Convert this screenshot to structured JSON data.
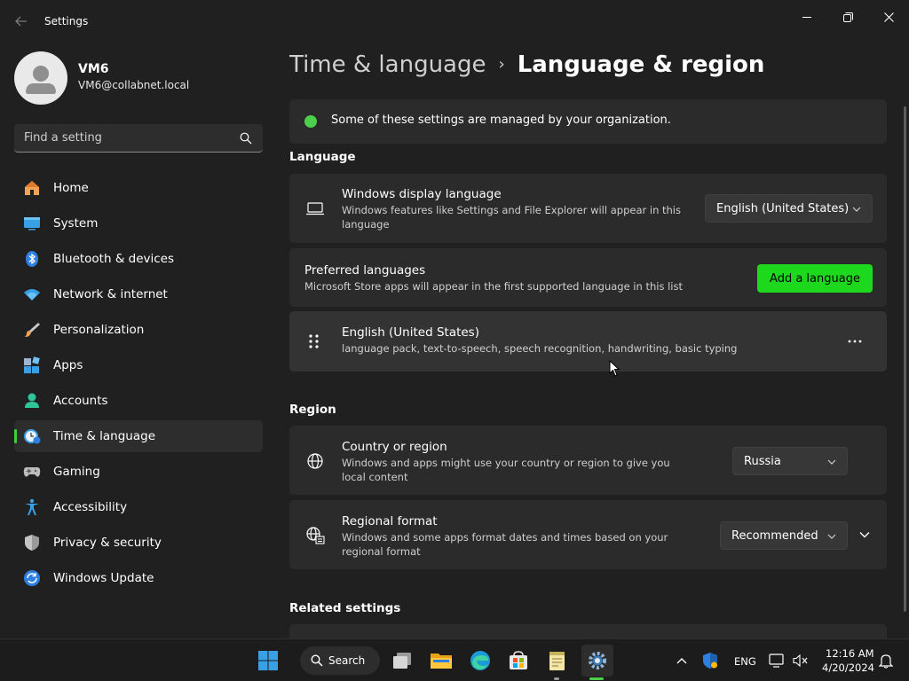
{
  "window": {
    "title": "Settings"
  },
  "profile": {
    "name": "VM6",
    "email": "VM6@collabnet.local"
  },
  "search": {
    "placeholder": "Find a setting"
  },
  "nav": {
    "items": [
      {
        "label": "Home",
        "icon": "home-icon"
      },
      {
        "label": "System",
        "icon": "system-icon"
      },
      {
        "label": "Bluetooth & devices",
        "icon": "bluetooth-icon"
      },
      {
        "label": "Network & internet",
        "icon": "wifi-icon"
      },
      {
        "label": "Personalization",
        "icon": "brush-icon"
      },
      {
        "label": "Apps",
        "icon": "apps-icon"
      },
      {
        "label": "Accounts",
        "icon": "accounts-icon"
      },
      {
        "label": "Time & language",
        "icon": "time-language-icon",
        "active": true
      },
      {
        "label": "Gaming",
        "icon": "gamepad-icon"
      },
      {
        "label": "Accessibility",
        "icon": "accessibility-icon"
      },
      {
        "label": "Privacy & security",
        "icon": "shield-icon"
      },
      {
        "label": "Windows Update",
        "icon": "update-icon"
      }
    ]
  },
  "breadcrumb": {
    "parent": "Time & language",
    "current": "Language & region"
  },
  "notice": {
    "text": "Some of these settings are managed by your organization."
  },
  "language": {
    "section_title": "Language",
    "display": {
      "title": "Windows display language",
      "description": "Windows features like Settings and File Explorer will appear in this language",
      "value": "English (United States)"
    },
    "preferred": {
      "title": "Preferred languages",
      "description": "Microsoft Store apps will appear in the first supported language in this list",
      "button": "Add a language"
    },
    "entry": {
      "title": "English (United States)",
      "description": "language pack, text-to-speech, speech recognition, handwriting, basic typing"
    }
  },
  "region": {
    "section_title": "Region",
    "country": {
      "title": "Country or region",
      "description": "Windows and apps might use your country or region to give you local content",
      "value": "Russia"
    },
    "format": {
      "title": "Regional format",
      "description": "Windows and some apps format dates and times based on your regional format",
      "value": "Recommended"
    }
  },
  "related": {
    "section_title": "Related settings"
  },
  "taskbar": {
    "search_label": "Search",
    "language": "ENG",
    "time": "12:16 AM",
    "date": "4/20/2024"
  },
  "colors": {
    "accent": "#3ad23a",
    "button": "#1ed81e",
    "background": "#202020",
    "card": "#2b2b2b"
  }
}
